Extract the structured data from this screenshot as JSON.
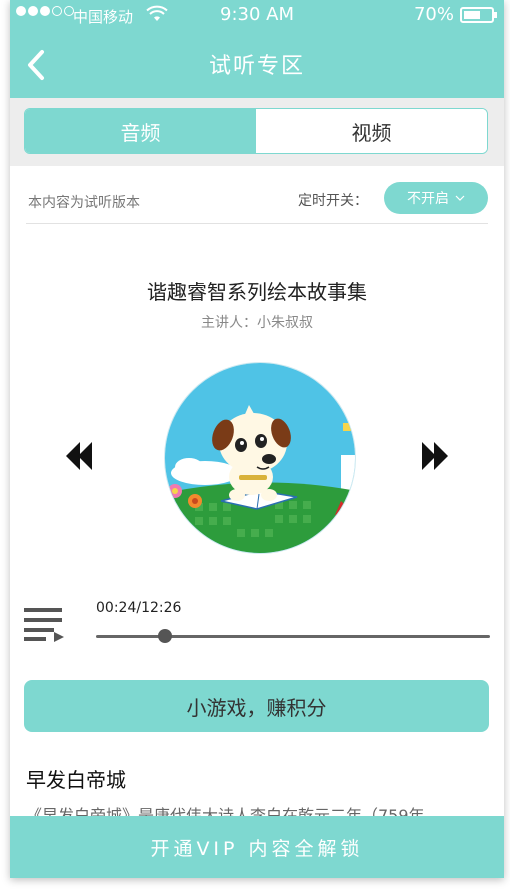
{
  "status": {
    "carrier": "中国移动",
    "time": "9:30 AM",
    "battery": "70%"
  },
  "header": {
    "title": "试听专区"
  },
  "tabs": [
    {
      "label": "音频",
      "active": true
    },
    {
      "label": "视频",
      "active": false
    }
  ],
  "info": {
    "trial_note": "本内容为试听版本",
    "timer_label": "定时开关：",
    "timer_value": "不开启"
  },
  "album": {
    "title": "谐趣睿智系列绘本故事集",
    "narrator": "主讲人：小朱叔叔"
  },
  "player": {
    "elapsed": "00:24/12:26",
    "progress": 0.047
  },
  "game_button": "小游戏，赚积分",
  "content": {
    "title": "早发白帝城",
    "text": "《早发白帝城》是唐代伟大诗人李白在乾元二年（759年"
  },
  "vip_bar": "开通VIP  内容全解锁",
  "colors": {
    "accent": "#7ed8d0"
  }
}
